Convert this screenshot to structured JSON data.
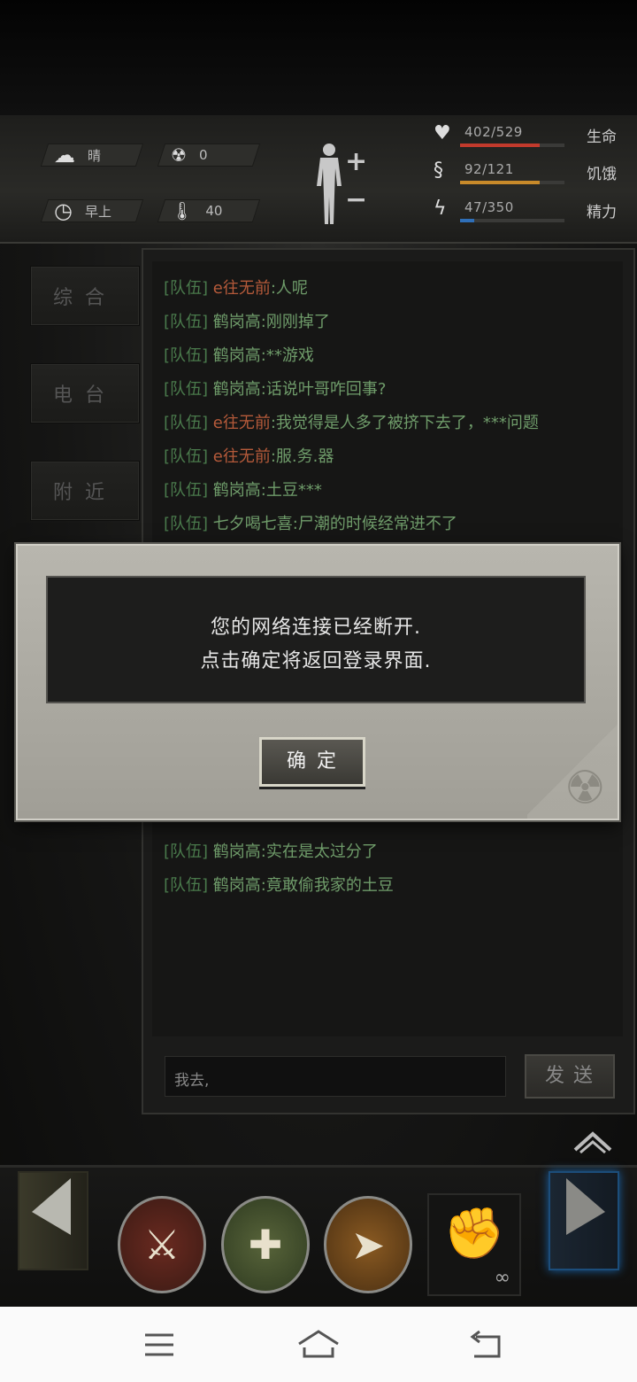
{
  "status": {
    "weather": {
      "icon": "cloud-sun-icon",
      "label": "晴"
    },
    "radiation": {
      "icon": "radiation-icon",
      "value": "0"
    },
    "time": {
      "icon": "clock-icon",
      "label": "早上"
    },
    "temperature": {
      "icon": "thermometer-icon",
      "value": "40"
    },
    "stats": [
      {
        "icon": "heart-icon",
        "value": "402/529",
        "label": "生命",
        "fraction": 0.76,
        "color": "#c23a2c"
      },
      {
        "icon": "stomach-icon",
        "value": "92/121",
        "label": "饥饿",
        "fraction": 0.76,
        "color": "#c88a2a"
      },
      {
        "icon": "energy-icon",
        "value": "47/350",
        "label": "精力",
        "fraction": 0.134,
        "color": "#2f6fb8"
      }
    ]
  },
  "tabs": [
    "综合",
    "电台",
    "附近"
  ],
  "chat": {
    "messages": [
      {
        "channel": "[队伍]",
        "name": "e往无前",
        "name_color": "red",
        "text": ":人呢"
      },
      {
        "channel": "[队伍]",
        "name": "鹤岗高",
        "name_color": "green",
        "text": ":刚刚掉了"
      },
      {
        "channel": "[队伍]",
        "name": "鹤岗高",
        "name_color": "green",
        "text": ":**游戏"
      },
      {
        "channel": "[队伍]",
        "name": "鹤岗高",
        "name_color": "green",
        "text": ":话说叶哥咋回事?"
      },
      {
        "channel": "[队伍]",
        "name": "e往无前",
        "name_color": "red",
        "text": ":我觉得是人多了被挤下去了，***问题"
      },
      {
        "channel": "[队伍]",
        "name": "e往无前",
        "name_color": "red",
        "text": ":服.务.器"
      },
      {
        "channel": "[队伍]",
        "name": "鹤岗高",
        "name_color": "green",
        "text": ":土豆***"
      },
      {
        "channel": "[队伍]",
        "name": "七夕喝七喜",
        "name_color": "green",
        "text": ":尸潮的时候经常进不了"
      },
      {
        "channel": "[队伍]",
        "name": "鹤岗高",
        "name_color": "green",
        "text": ":实在是太过分了"
      },
      {
        "channel": "[队伍]",
        "name": "鹤岗高",
        "name_color": "green",
        "text": ":竟敢偷我家的土豆"
      }
    ],
    "input_value": "我去,",
    "send_label": "发送"
  },
  "dialog": {
    "line1": "您的网络连接已经断开.",
    "line2": "点击确定将返回登录界面.",
    "ok_label": "确定"
  },
  "action_bar": {
    "skills": [
      {
        "icon": "crossed-weapons-icon"
      },
      {
        "icon": "meditate-heal-icon"
      },
      {
        "icon": "sprint-icon"
      }
    ],
    "fist": {
      "icon": "fist-icon",
      "count": "∞"
    }
  },
  "navbar": {
    "menu_icon": "menu-icon",
    "home_icon": "home-icon",
    "back_icon": "back-icon"
  }
}
